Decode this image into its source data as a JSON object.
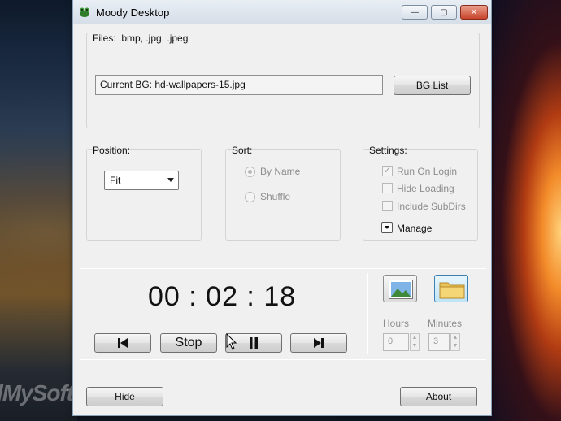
{
  "window": {
    "title": "Moody Desktop"
  },
  "titlebar": {
    "minimize": "—",
    "maximize": "▢",
    "close": "✕"
  },
  "files": {
    "label": "Files: .bmp, .jpg, .jpeg",
    "current_bg": "Current BG: hd-wallpapers-15.jpg",
    "bg_list_button": "BG List"
  },
  "position": {
    "label": "Position:",
    "selected": "Fit"
  },
  "sort": {
    "label": "Sort:",
    "options": [
      {
        "label": "By Name",
        "selected": true
      },
      {
        "label": "Shuffle",
        "selected": false
      }
    ]
  },
  "settings": {
    "label": "Settings:",
    "items": [
      {
        "label": "Run On Login",
        "checked": true
      },
      {
        "label": "Hide Loading",
        "checked": false
      },
      {
        "label": "Include SubDirs",
        "checked": false
      }
    ],
    "manage": "Manage"
  },
  "player": {
    "timer": "00 : 02 : 18",
    "stop": "Stop"
  },
  "interval": {
    "hours_label": "Hours",
    "minutes_label": "Minutes",
    "hours_value": "0",
    "minutes_value": "3"
  },
  "footer": {
    "hide": "Hide",
    "about": "About"
  },
  "watermark": "lMySoft"
}
